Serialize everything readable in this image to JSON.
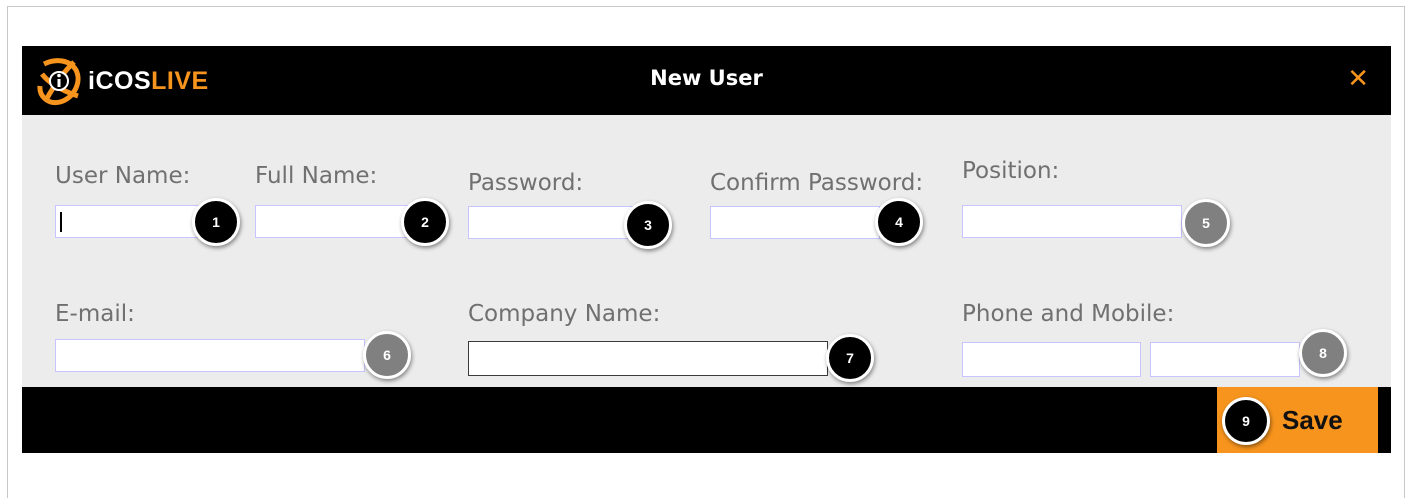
{
  "dialog": {
    "title": "New User",
    "brand": {
      "part1": "iCOS",
      "part2": "LIVE"
    },
    "close_glyph": "✕"
  },
  "fields": {
    "user_name": {
      "label": "User Name:",
      "value": "",
      "badge": "1"
    },
    "full_name": {
      "label": "Full Name:",
      "value": "",
      "badge": "2"
    },
    "password": {
      "label": "Password:",
      "value": "",
      "badge": "3"
    },
    "confirm_password": {
      "label": "Confirm Password:",
      "value": "",
      "badge": "4"
    },
    "position": {
      "label": "Position:",
      "value": "",
      "badge": "5"
    },
    "email": {
      "label": "E-mail:",
      "value": "",
      "badge": "6"
    },
    "company_name": {
      "label": "Company Name:",
      "value": "",
      "badge": "7"
    },
    "phone": {
      "label": "Phone and Mobile:",
      "value": "",
      "mobile_value": "",
      "badge": "8"
    }
  },
  "footer": {
    "save_label": "Save",
    "badge": "9"
  },
  "colors": {
    "accent": "#f7941d",
    "titlebar": "#000000",
    "body_bg": "#ececec"
  },
  "icons": {
    "logo": "icos-logo-icon",
    "close": "close-icon"
  }
}
